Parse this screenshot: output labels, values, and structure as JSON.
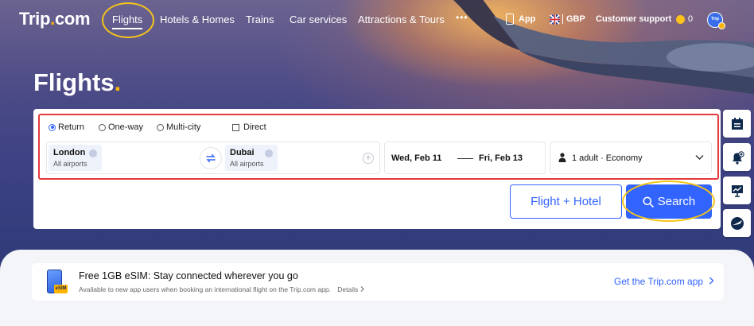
{
  "nav": {
    "logo": "Trip",
    "logo_dot": ".",
    "logo_tail": "com",
    "items": [
      "Flights",
      "Hotels & Homes",
      "Trains",
      "Car services",
      "Attractions & Tours"
    ],
    "more": "•••",
    "app": "App",
    "currency": "GBP",
    "support": "Customer support",
    "coins": "0",
    "avatar": "Trip"
  },
  "page": {
    "title": "Flights",
    "title_dot": "."
  },
  "search": {
    "trip_types": [
      "Return",
      "One-way",
      "Multi-city"
    ],
    "selected_trip_type": "Return",
    "direct_label": "Direct",
    "from_city": "London",
    "from_sub": "All airports",
    "to_city": "Dubai",
    "to_sub": "All airports",
    "depart_date": "Wed, Feb 11",
    "return_date": "Fri, Feb 13",
    "passengers": "1 adult · Economy",
    "flight_hotel_label": "Flight + Hotel",
    "search_label": "Search"
  },
  "promo": {
    "badge": "eSIM",
    "title": "Free 1GB eSIM: Stay connected wherever you go",
    "subtitle": "Available to new app users when booking an international flight on the Trip.com app.",
    "details": "Details",
    "cta": "Get the Trip.com app"
  },
  "colors": {
    "accent": "#3264ff",
    "brand_dot": "#ffb400",
    "highlight": "#f5c518",
    "frame": "#e4393c"
  },
  "icons": [
    "app-icon",
    "uk-flag-icon",
    "coin-icon",
    "swap-icon",
    "plus-icon",
    "person-icon",
    "chevron-down-icon",
    "search-icon",
    "itinerary-icon",
    "price-alert-icon",
    "trends-icon",
    "flight-status-icon",
    "phone-icon",
    "chevron-right-icon"
  ]
}
